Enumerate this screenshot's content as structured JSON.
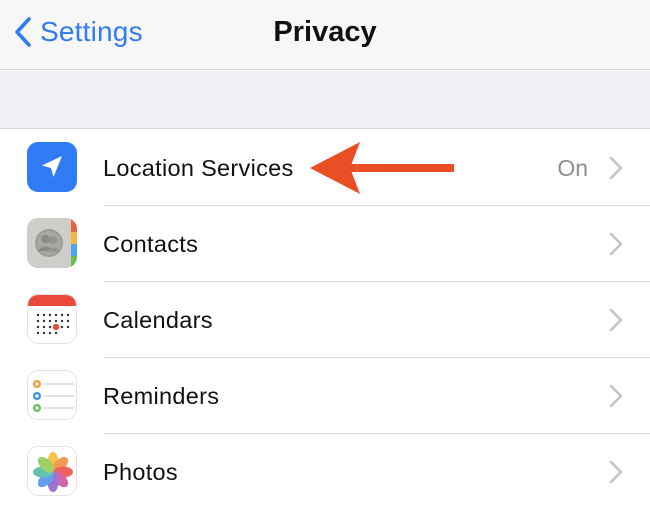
{
  "navbar": {
    "back_label": "Settings",
    "title": "Privacy"
  },
  "rows": [
    {
      "label": "Location Services",
      "value": "On",
      "icon": "location-arrow-icon"
    },
    {
      "label": "Contacts",
      "value": "",
      "icon": "contacts-icon"
    },
    {
      "label": "Calendars",
      "value": "",
      "icon": "calendar-icon"
    },
    {
      "label": "Reminders",
      "value": "",
      "icon": "reminders-icon"
    },
    {
      "label": "Photos",
      "value": "",
      "icon": "photos-icon"
    }
  ],
  "colors": {
    "accent": "#2f7cf6",
    "annotation_arrow": "#ea4e26",
    "location_icon_bg": "#2f7cf6",
    "calendar_red": "#e94a3c"
  }
}
